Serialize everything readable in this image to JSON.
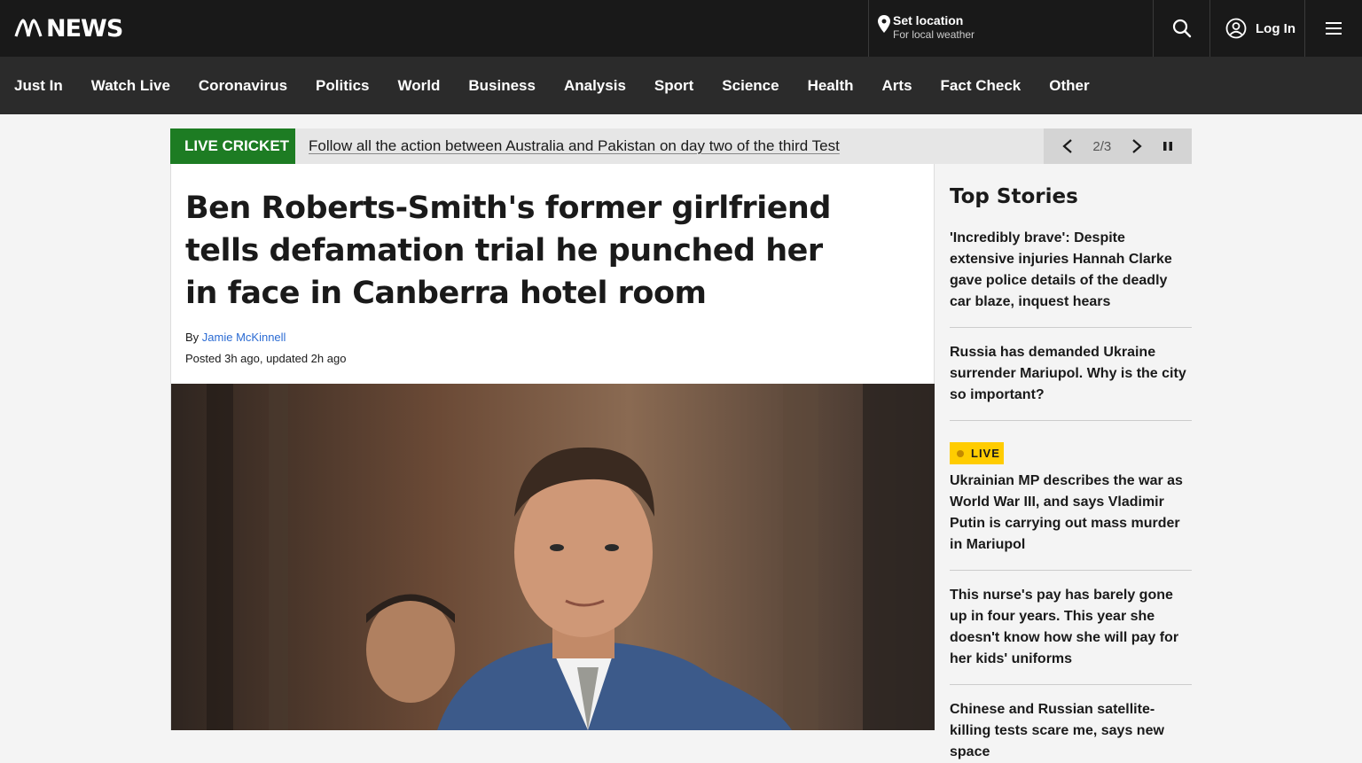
{
  "header": {
    "logo_text": "NEWS",
    "location_title": "Set location",
    "location_subtitle": "For local weather",
    "login_label": "Log In"
  },
  "nav": {
    "items": [
      "Just In",
      "Watch Live",
      "Coronavirus",
      "Politics",
      "World",
      "Business",
      "Analysis",
      "Sport",
      "Science",
      "Health",
      "Arts",
      "Fact Check",
      "Other"
    ]
  },
  "ticker": {
    "tag": "LIVE CRICKET",
    "message": "Follow all the action between Australia and Pakistan on day two of the third Test",
    "counter": "2/3"
  },
  "article": {
    "headline": "Ben Roberts-Smith's former girlfriend tells defamation trial he punched her in face in Canberra hotel room",
    "by_prefix": "By",
    "author": "Jamie McKinnell",
    "posted": "Posted 3h ago, updated 2h ago"
  },
  "sidebar": {
    "title": "Top Stories",
    "live_label": "LIVE",
    "stories": [
      "'Incredibly brave': Despite extensive injuries Hannah Clarke gave police details of the deadly car blaze, inquest hears",
      "Russia has demanded Ukraine surrender Mariupol. Why is the city so important?",
      "Ukrainian MP describes the war as World War III, and says Vladimir Putin is carrying out mass murder in Mariupol",
      "This nurse's pay has barely gone up in four years. This year she doesn't know how she will pay for her kids' uniforms",
      "Chinese and Russian satellite-killing tests scare me, says new space"
    ]
  },
  "colors": {
    "header_bg": "#191919",
    "nav_bg": "#2b2b2b",
    "live_cricket_green": "#1d7c23",
    "live_badge_yellow": "#ffcc00",
    "link_blue": "#2b6bd3"
  }
}
